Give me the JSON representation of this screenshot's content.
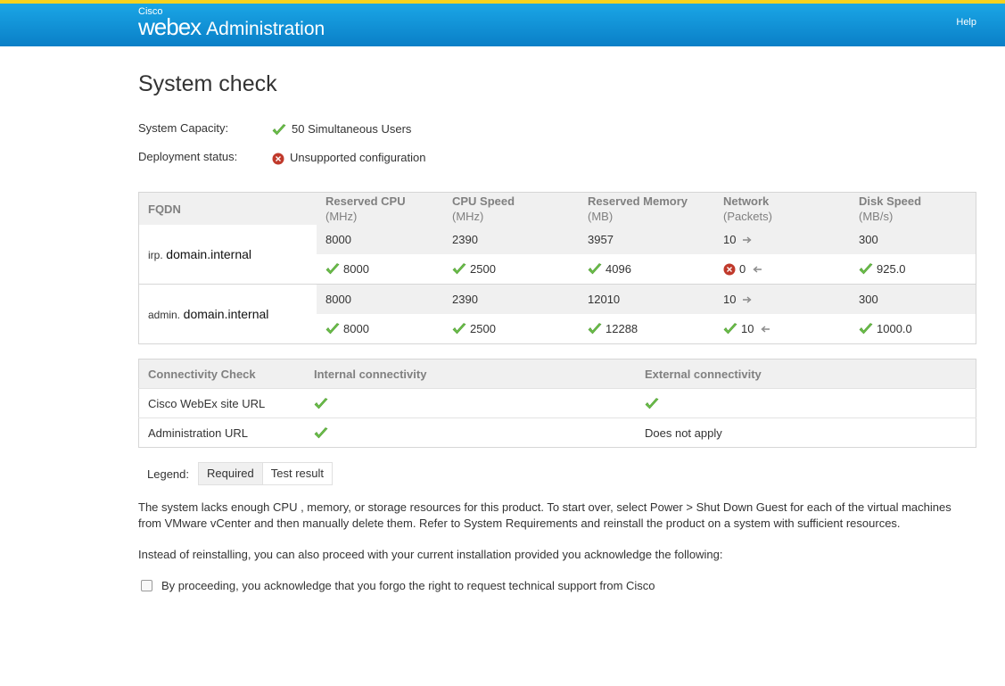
{
  "header": {
    "brand_small": "Cisco",
    "brand_main": "webex",
    "app": "Administration",
    "help": "Help"
  },
  "page": {
    "title": "System check"
  },
  "summary": {
    "capacity_label": "System Capacity:",
    "capacity_value": "50 Simultaneous Users",
    "deployment_label": "Deployment status:",
    "deployment_value": "Unsupported configuration"
  },
  "capacity_table": {
    "headers": [
      {
        "title": "FQDN",
        "unit": ""
      },
      {
        "title": "Reserved CPU",
        "unit": "(MHz)"
      },
      {
        "title": "CPU Speed",
        "unit": "(MHz)"
      },
      {
        "title": "Reserved Memory",
        "unit": "(MB)"
      },
      {
        "title": "Network",
        "unit": "(Packets)"
      },
      {
        "title": "Disk Speed",
        "unit": "(MB/s)"
      }
    ],
    "hosts": [
      {
        "prefix": "irp.",
        "domain": "domain.internal",
        "required": [
          "8000",
          "2390",
          "3957",
          "10",
          "300"
        ],
        "results": [
          "8000",
          "2500",
          "4096",
          "0",
          "925.0"
        ]
      },
      {
        "prefix": "admin.",
        "domain": "domain.internal",
        "required": [
          "8000",
          "2390",
          "12010",
          "10",
          "300"
        ],
        "results": [
          "8000",
          "2500",
          "12288",
          "10",
          "1000.0"
        ]
      }
    ]
  },
  "connectivity": {
    "headers": [
      "Connectivity Check",
      "Internal connectivity",
      "External connectivity"
    ],
    "rows": [
      {
        "name": "Cisco WebEx site URL",
        "external_text": ""
      },
      {
        "name": "Administration URL",
        "external_text": "Does not apply"
      }
    ]
  },
  "legend": {
    "label": "Legend:",
    "required": "Required",
    "test_result": "Test result"
  },
  "message": {
    "paragraph1": "The system lacks enough CPU , memory, or storage resources for this product. To start over, select Power > Shut Down Guest for each of the virtual machines from VMware vCenter and then manually delete them. Refer to System Requirements and reinstall the product on a system with sufficient resources.",
    "paragraph2": "Instead of reinstalling, you can also proceed with your current installation provided you acknowledge the following:",
    "ack_label": "By proceeding, you acknowledge that you forgo the right to request technical support from Cisco"
  },
  "colors": {
    "header_blue": "#1aa6e6",
    "accent_yellow": "#f5d21f",
    "check_green": "#6cc04a",
    "error_red": "#c0392b"
  },
  "icons": {
    "pass": "check-icon",
    "fail": "error-icon",
    "out": "arrow-right-icon",
    "in": "arrow-left-icon"
  }
}
